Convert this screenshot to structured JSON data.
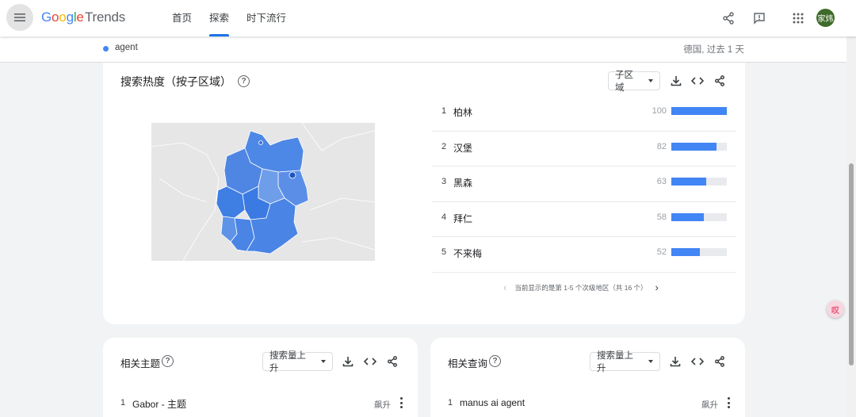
{
  "header": {
    "logo_google": "Google",
    "logo_product": "Trends",
    "nav": [
      {
        "label": "首页",
        "active": false
      },
      {
        "label": "探索",
        "active": true
      },
      {
        "label": "时下流行",
        "active": false
      }
    ],
    "avatar_text": "家炜",
    "icons": [
      "menu-icon",
      "share-icon",
      "feedback-icon",
      "apps-icon"
    ]
  },
  "subheader": {
    "term": "agent",
    "term_color": "#4285f4",
    "scope": "德国, 过去 1 天"
  },
  "region_card": {
    "title": "搜索热度（按子区域）",
    "select_label": "子区域",
    "regions": [
      {
        "rank": "1",
        "name": "柏林",
        "value": "100",
        "score": 100
      },
      {
        "rank": "2",
        "name": "汉堡",
        "value": "82",
        "score": 82
      },
      {
        "rank": "3",
        "name": "黑森",
        "value": "63",
        "score": 63
      },
      {
        "rank": "4",
        "name": "拜仁",
        "value": "58",
        "score": 58
      },
      {
        "rank": "5",
        "name": "不来梅",
        "value": "52",
        "score": 52
      }
    ],
    "pager_text": "当前显示的是第 1-5 个次级地区（共 16 个）"
  },
  "related_topics": {
    "title": "相关主题",
    "select_label": "搜索量上升",
    "items": [
      {
        "rank": "1",
        "name": "Gabor - 主题",
        "badge": "飙升"
      }
    ]
  },
  "related_queries": {
    "title": "相关查询",
    "select_label": "搜索量上升",
    "items": [
      {
        "rank": "1",
        "name": "manus ai agent",
        "badge": "飙升"
      }
    ]
  },
  "colors": {
    "accent": "#1a73e8",
    "series": "#4285f4",
    "avatar": "#3e6b29"
  },
  "extension_badge": "叹"
}
